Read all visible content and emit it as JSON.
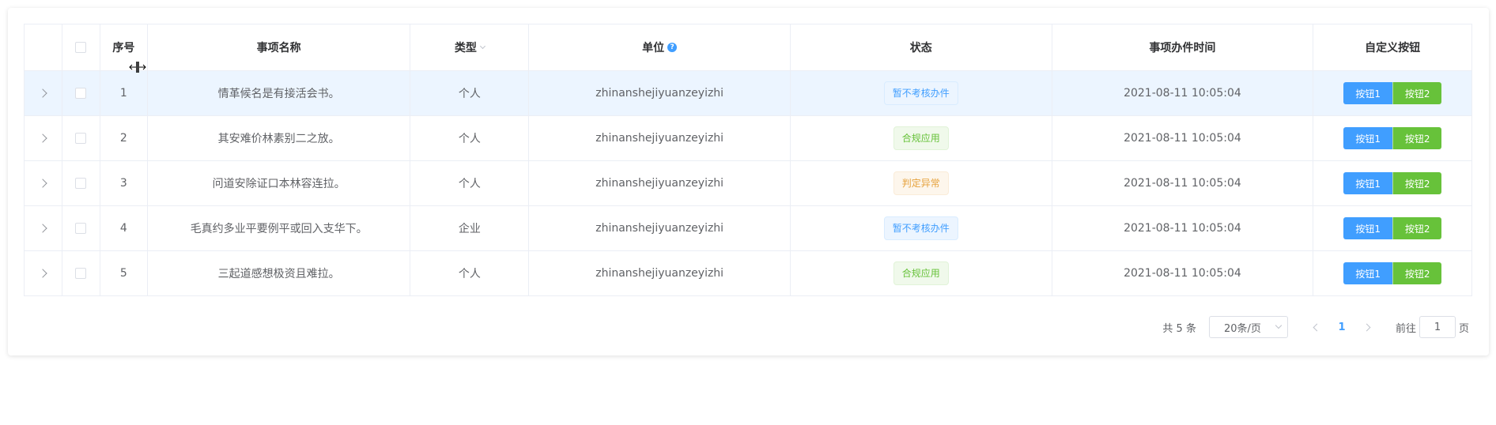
{
  "table": {
    "headers": {
      "index": "序号",
      "name": "事项名称",
      "type": "类型",
      "unit": "单位",
      "status": "状态",
      "time": "事项办件时间",
      "ops": "自定义按钮"
    },
    "rows": [
      {
        "index": "1",
        "name": "情革候名是有接活会书。",
        "type": "个人",
        "unit": "zhinanshejiyuanzeyizhi",
        "status": "暂不考核办件",
        "status_color": "blue",
        "time": "2021-08-11 10:05:04",
        "btn1": "按钮1",
        "btn2": "按钮2"
      },
      {
        "index": "2",
        "name": "其安难价林素别二之放。",
        "type": "个人",
        "unit": "zhinanshejiyuanzeyizhi",
        "status": "合规应用",
        "status_color": "green",
        "time": "2021-08-11 10:05:04",
        "btn1": "按钮1",
        "btn2": "按钮2"
      },
      {
        "index": "3",
        "name": "问道安除证口本林容连拉。",
        "type": "个人",
        "unit": "zhinanshejiyuanzeyizhi",
        "status": "判定异常",
        "status_color": "orange",
        "time": "2021-08-11 10:05:04",
        "btn1": "按钮1",
        "btn2": "按钮2"
      },
      {
        "index": "4",
        "name": "毛真约多业平要例平或回入支华下。",
        "type": "企业",
        "unit": "zhinanshejiyuanzeyizhi",
        "status": "暂不考核办件",
        "status_color": "blue",
        "time": "2021-08-11 10:05:04",
        "btn1": "按钮1",
        "btn2": "按钮2"
      },
      {
        "index": "5",
        "name": "三起道感想极资且难拉。",
        "type": "个人",
        "unit": "zhinanshejiyuanzeyizhi",
        "status": "合规应用",
        "status_color": "green",
        "time": "2021-08-11 10:05:04",
        "btn1": "按钮1",
        "btn2": "按钮2"
      }
    ]
  },
  "pagination": {
    "total_text": "共 5 条",
    "page_size": "20条/页",
    "current_page": "1",
    "goto_label": "前往",
    "goto_value": "1",
    "page_suffix": "页"
  },
  "colors": {
    "primary": "#409eff",
    "success": "#67c23a",
    "warning": "#e6a23c",
    "highlight_row": "#ecf5ff"
  }
}
